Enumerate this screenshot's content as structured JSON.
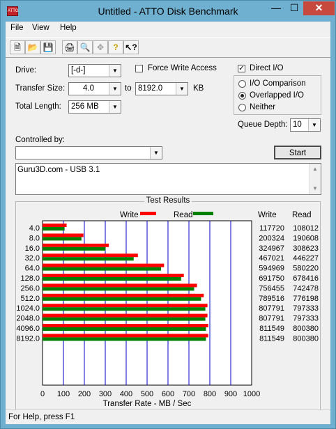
{
  "window": {
    "title": "Untitled - ATTO Disk Benchmark",
    "app_icon_text": "ATTO"
  },
  "menu": {
    "file": "File",
    "view": "View",
    "help": "Help"
  },
  "form": {
    "drive_label": "Drive:",
    "drive_value": "[-d-]",
    "force_write_label": "Force Write Access",
    "force_write_checked": false,
    "direct_io_label": "Direct I/O",
    "direct_io_checked": true,
    "transfer_size_label": "Transfer Size:",
    "transfer_from": "4.0",
    "to_label": "to",
    "transfer_to": "8192.0",
    "kb_label": "KB",
    "total_length_label": "Total Length:",
    "total_length_value": "256 MB",
    "io_comparison_label": "I/O Comparison",
    "overlapped_io_label": "Overlapped I/O",
    "neither_label": "Neither",
    "selected_mode": "Overlapped I/O",
    "queue_depth_label": "Queue Depth:",
    "queue_depth_value": "10",
    "controlled_by_label": "Controlled by:",
    "controlled_by_value": "",
    "start_label": "Start",
    "description": "Guru3D.com - USB 3.1"
  },
  "results": {
    "title": "Test Results",
    "write_legend": "Write",
    "read_legend": "Read",
    "write_col": "Write",
    "read_col": "Read",
    "write_color": "#ff0000",
    "read_color": "#008000"
  },
  "chart_data": {
    "type": "bar",
    "orientation": "horizontal",
    "categories": [
      "4.0",
      "8.0",
      "16.0",
      "32.0",
      "64.0",
      "128.0",
      "256.0",
      "512.0",
      "1024.0",
      "2048.0",
      "4096.0",
      "8192.0"
    ],
    "series": [
      {
        "name": "Write",
        "color": "#ff0000",
        "values": [
          117720,
          200324,
          324967,
          467021,
          594969,
          691750,
          756455,
          789516,
          807791,
          807791,
          811549,
          811549
        ]
      },
      {
        "name": "Read",
        "color": "#008000",
        "values": [
          108012,
          190608,
          308623,
          446227,
          580220,
          678416,
          742478,
          776198,
          797333,
          797333,
          800380,
          800380
        ]
      }
    ],
    "xlabel": "Transfer Rate - MB / Sec",
    "xticks": [
      "0",
      "100",
      "200",
      "300",
      "400",
      "500",
      "600",
      "700",
      "800",
      "900",
      "1000"
    ],
    "xlim": [
      0,
      1000
    ],
    "grid": true
  },
  "status": {
    "text": "For Help, press F1"
  }
}
